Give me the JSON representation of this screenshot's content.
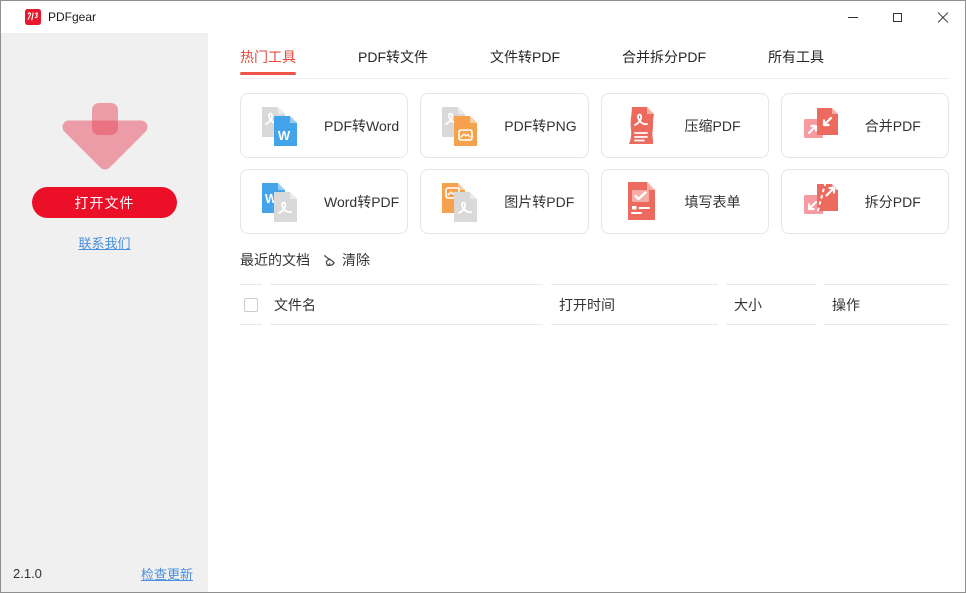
{
  "window": {
    "title": "PDFgear",
    "controls": [
      {
        "id": "minimize",
        "icon": "minimize-icon"
      },
      {
        "id": "maximize",
        "icon": "maximize-icon"
      },
      {
        "id": "close",
        "icon": "close-icon"
      }
    ]
  },
  "sidebar": {
    "open_button": "打开文件",
    "contact_link": "联系我们",
    "version": "2.1.0",
    "update_link": "检查更新",
    "arrow_icon": "download-arrow-icon"
  },
  "tabs": [
    {
      "id": "hot-tools",
      "label": "热门工具",
      "active": true
    },
    {
      "id": "pdf-to-file",
      "label": "PDF转文件",
      "active": false
    },
    {
      "id": "file-to-pdf",
      "label": "文件转PDF",
      "active": false
    },
    {
      "id": "merge-split-pdf",
      "label": "合并拆分PDF",
      "active": false
    },
    {
      "id": "all-tools",
      "label": "所有工具",
      "active": false
    }
  ],
  "tools": [
    {
      "id": "pdf-to-word",
      "label": "PDF转Word",
      "icon": "pdf-to-word-icon"
    },
    {
      "id": "pdf-to-png",
      "label": "PDF转PNG",
      "icon": "pdf-to-png-icon"
    },
    {
      "id": "compress-pdf",
      "label": "压缩PDF",
      "icon": "compress-pdf-icon"
    },
    {
      "id": "merge-pdf",
      "label": "合并PDF",
      "icon": "merge-pdf-icon"
    },
    {
      "id": "word-to-pdf",
      "label": "Word转PDF",
      "icon": "word-to-pdf-icon"
    },
    {
      "id": "image-to-pdf",
      "label": "图片转PDF",
      "icon": "image-to-pdf-icon"
    },
    {
      "id": "fill-form",
      "label": "填写表单",
      "icon": "fill-form-icon"
    },
    {
      "id": "split-pdf",
      "label": "拆分PDF",
      "icon": "split-pdf-icon"
    }
  ],
  "recent": {
    "title": "最近的文档",
    "clear_label": "清除",
    "clear_icon": "broom-icon"
  },
  "table": {
    "columns": [
      "文件名",
      "打开时间",
      "大小",
      "操作"
    ],
    "rows": []
  },
  "colors": {
    "accent_red": "#ec0f28",
    "tab_active_red": "#e8473a",
    "link_blue": "#4a8fdd",
    "icon_red": "#ed6a5e",
    "icon_pink": "#f59ba0",
    "icon_blue": "#43a4ea",
    "icon_orange": "#f6a14d",
    "icon_gray": "#d9d9d9",
    "sidebar_bg": "#f0f0f0"
  }
}
